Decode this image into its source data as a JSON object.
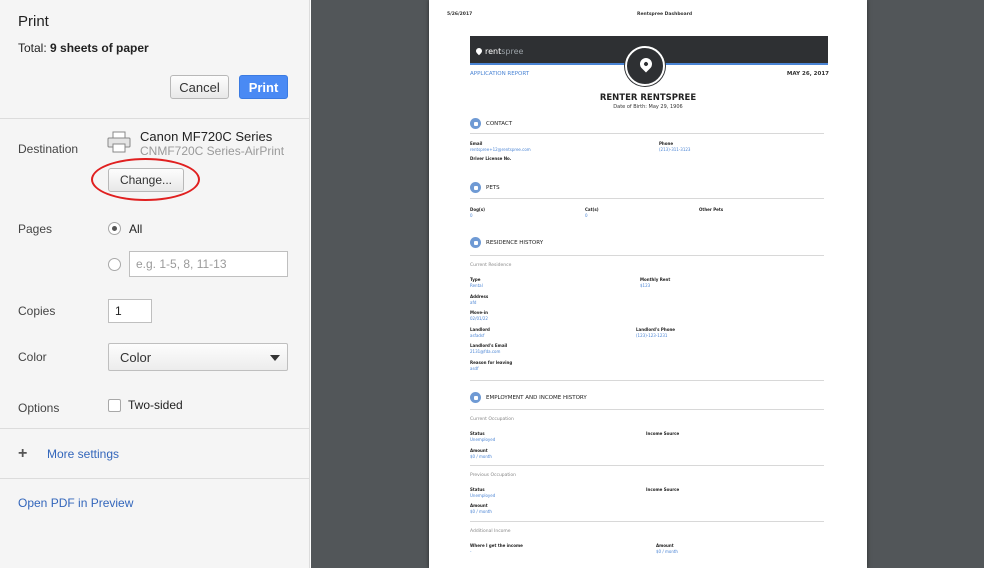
{
  "dialog": {
    "title": "Print",
    "total_prefix": "Total: ",
    "total_value": "9 sheets of paper",
    "cancel_label": "Cancel",
    "print_label": "Print"
  },
  "destination": {
    "label": "Destination",
    "printer_name": "Canon MF720C Series",
    "printer_sub": "CNMF720C Series-AirPrint",
    "change_label": "Change..."
  },
  "pages": {
    "label": "Pages",
    "all_label": "All",
    "range_placeholder": "e.g. 1-5, 8, 11-13"
  },
  "copies": {
    "label": "Copies",
    "value": "1"
  },
  "color": {
    "label": "Color",
    "selected": "Color"
  },
  "options": {
    "label": "Options",
    "two_sided_label": "Two-sided"
  },
  "more_settings_label": "More settings",
  "open_pdf_label": "Open PDF in Preview",
  "preview": {
    "header_date": "5/26/2017",
    "header_title": "Rentspree Dashboard",
    "logo_rent": "rent",
    "logo_spree": "spree",
    "app_report": "APPLICATION REPORT",
    "report_date": "MAY 26, 2017",
    "renter_name": "RENTER RENTSPREE",
    "dob": "Date of Birth: May 29, 1906",
    "contact": {
      "title": "CONTACT",
      "email_label": "Email",
      "email_value": "rentspree+12@rentspree.com",
      "phone_label": "Phone",
      "phone_value": "(213)-311-3123",
      "license_label": "Driver License No."
    },
    "pets": {
      "title": "PETS",
      "dogs_label": "Dog(s)",
      "dogs_value": "0",
      "cats_label": "Cat(s)",
      "cats_value": "0",
      "other_label": "Other Pets"
    },
    "residence": {
      "title": "RESIDENCE HISTORY",
      "current": "Current Residence",
      "type_label": "Type",
      "type_value": "Rental",
      "rent_label": "Monthly Rent",
      "rent_value": "$123",
      "address_label": "Address",
      "address_value": "afd",
      "movein_label": "Move-in",
      "movein_value": "02/01/22",
      "landlord_label": "Landlord",
      "landlord_value": "asfadsf",
      "landlord_phone_label": "Landlord's Phone",
      "landlord_phone_value": "(123)-123-1231",
      "landlord_email_label": "Landlord's Email",
      "landlord_email_value": "2131@fda.com",
      "reason_label": "Reason for leaving",
      "reason_value": "asdf"
    },
    "employment": {
      "title": "EMPLOYMENT AND INCOME HISTORY",
      "current": "Current Occupation",
      "status_label": "Status",
      "status_value": "Unemployed",
      "income_source_label": "Income Source",
      "amount_label": "Amount",
      "amount_value": "$0 / month",
      "previous": "Previous Occupation",
      "prev_status_value": "Unemployed",
      "prev_amount_value": "$0 / month",
      "additional": "Additional Income",
      "where_label": "Where I get the income",
      "where_value": "-",
      "add_amount_value": "$0 / month"
    }
  }
}
